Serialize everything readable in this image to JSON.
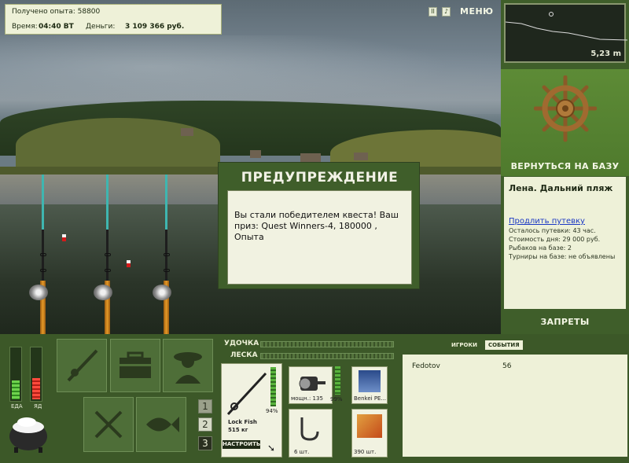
{
  "info": {
    "experience_label": "Получено опыта:",
    "experience_value": "58800",
    "time_label": "Время:",
    "time_value": "04:40 ВТ",
    "money_label": "Деньги:",
    "money_value": "3 109 366 руб."
  },
  "top_icons": [
    "pause-icon",
    "sound-icon"
  ],
  "menu_label": "МЕНЮ",
  "depth": {
    "value": "5,23 m"
  },
  "right_panel": {
    "return_label": "ВЕРНУТЬСЯ НА БАЗУ",
    "location": "Лена. Дальний пляж",
    "extend_link": "Продлить путевку",
    "permit_left": "Осталось путевки: 43 час.",
    "day_cost": "Стоимость дня: 29 000 руб.",
    "anglers": "Рыбаков на базе: 2",
    "tournaments": "Турниры на базе: не объявлены",
    "bans_label": "ЗАПРЕТЫ"
  },
  "modal": {
    "title": "ПРЕДУПРЕЖДЕНИЕ",
    "message": "Вы стали победителем квеста! Ваш приз: Quest Winners-4, 180000 , Опыта"
  },
  "status": {
    "food_label": "ЕДА",
    "food_level": 0.35,
    "poison_label": "ЯД",
    "poison_level": 0.4
  },
  "rod_slots": [
    "1",
    "2",
    "3"
  ],
  "tackle": {
    "rod_label": "УДОЧКА",
    "line_label": "ЛЕСКА",
    "rod_percent": "94%",
    "rod_name": "Lock Fish",
    "rod_weight": "515 кг",
    "setup_button": "НАСТРОИТЬ",
    "reel_power": "мощн.: 135",
    "reel_percent": "99%",
    "line_name": "Benkei PE...",
    "hooks_count": "6 шт.",
    "bait_count": "390 шт."
  },
  "players": {
    "tab_players": "ИГРОКИ",
    "tab_events": "СОБЫТИЯ",
    "rows": [
      {
        "name": "Fedotov",
        "score": "56"
      }
    ]
  }
}
